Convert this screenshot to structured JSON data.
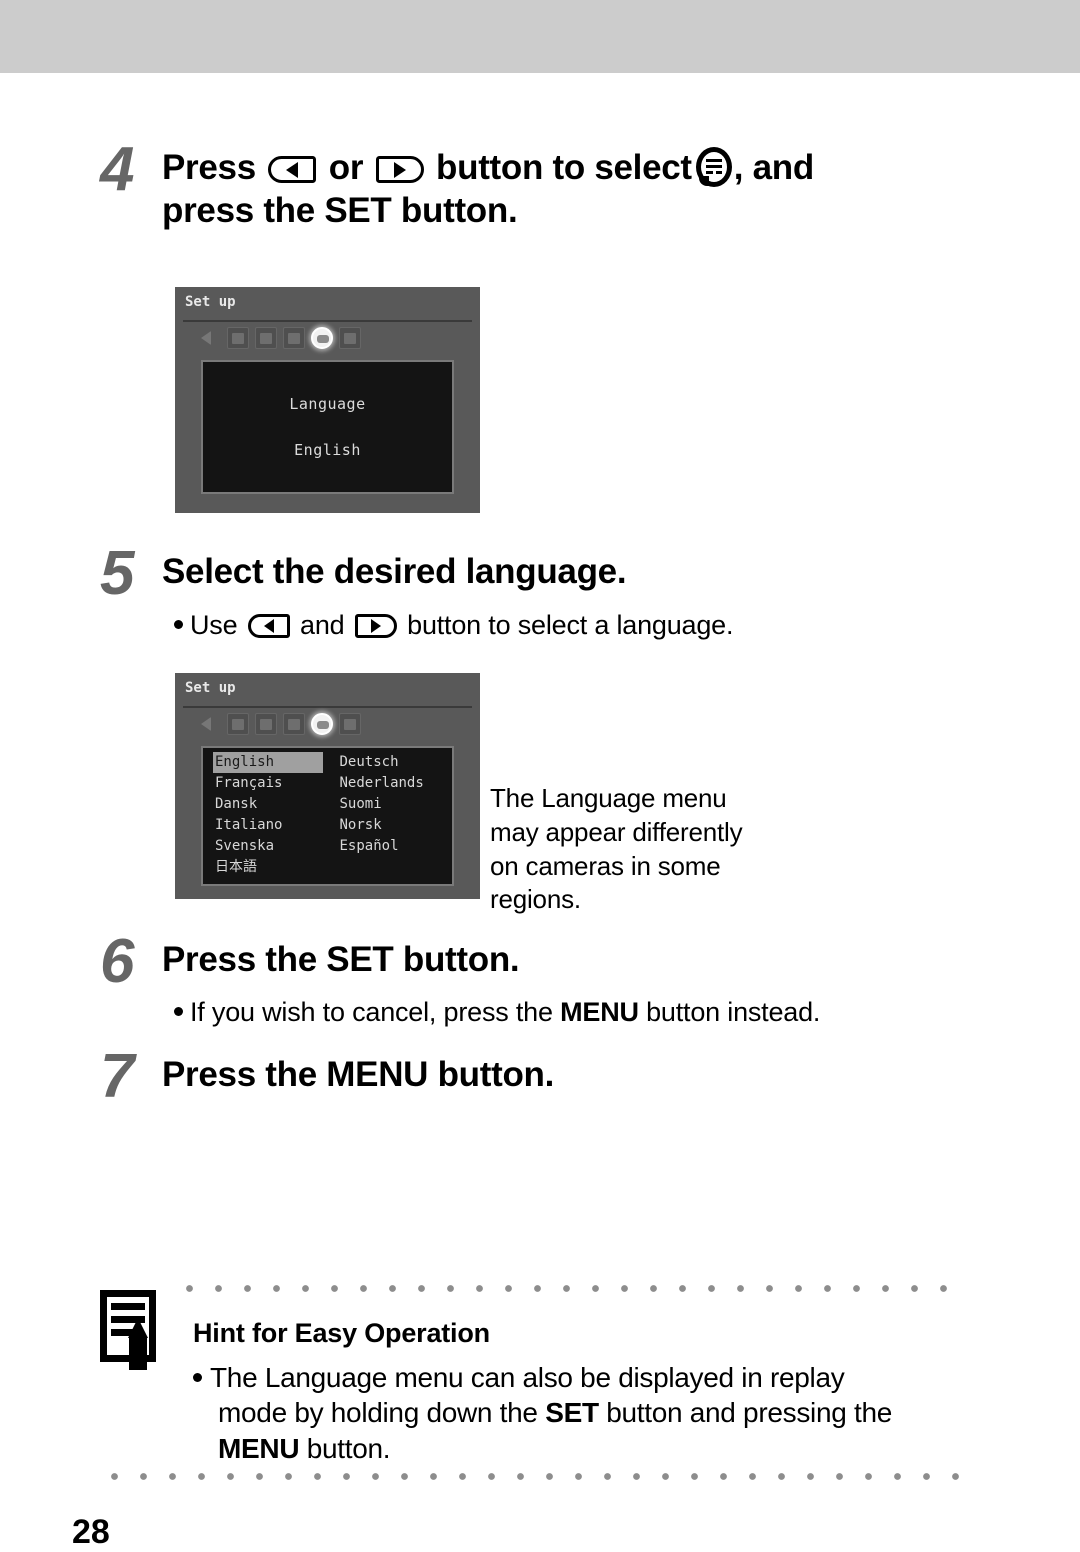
{
  "page": {
    "number": "28",
    "top_band_color": "#cccccc",
    "step_number_color": "#666666"
  },
  "steps": [
    {
      "number": "4",
      "heading_part1": "Press",
      "heading_or": "or",
      "heading_part2": "button to select",
      "heading_part3": ", and",
      "heading_line2": "press the SET button.",
      "icon_left": "left-arrow-button-icon",
      "icon_right": "right-arrow-button-icon",
      "icon_menu": "language-menu-icon"
    },
    {
      "number": "5",
      "heading": "Select the desired language.",
      "bullet_part1": "Use",
      "bullet_and": "and",
      "bullet_part2": "button to select a language."
    },
    {
      "number": "6",
      "heading": "Press the SET button.",
      "bullet_part1": "If you wish to cancel, press the ",
      "bullet_bold": "MENU",
      "bullet_part2": " button instead."
    },
    {
      "number": "7",
      "heading": "Press the MENU button."
    }
  ],
  "lcd_one": {
    "title": "Set up",
    "icons": [
      "speaker-icon",
      "settings-icon",
      "date-icon",
      "format-icon",
      "language-icon-selected",
      "reset-icon"
    ],
    "panel_label": "Language",
    "panel_value": "English"
  },
  "lcd_two": {
    "title": "Set up",
    "icons": [
      "speaker-icon",
      "settings-icon",
      "date-icon",
      "format-icon",
      "language-icon-selected",
      "reset-icon"
    ],
    "languages_left": [
      "English",
      "Français",
      "Dansk",
      "Italiano",
      "Svenska",
      "日本語"
    ],
    "languages_right": [
      "Deutsch",
      "Nederlands",
      "Suomi",
      "Norsk",
      "Español"
    ],
    "selected": "English"
  },
  "side_note": {
    "text": "The Language menu may appear differently on cameras in some regions.",
    "line1": "The Language menu",
    "line2": "may appear differently",
    "line3": "on cameras in some",
    "line4": "regions."
  },
  "hint": {
    "icon": "note-pencil-icon",
    "title": "Hint for Easy Operation",
    "body_part1": "The Language menu can also be displayed in replay",
    "body_part2_pre": "mode by holding down the ",
    "body_part2_bold": "SET",
    "body_part2_post": " button and pressing the",
    "body_part3_bold": "MENU",
    "body_part3_post": " button."
  }
}
